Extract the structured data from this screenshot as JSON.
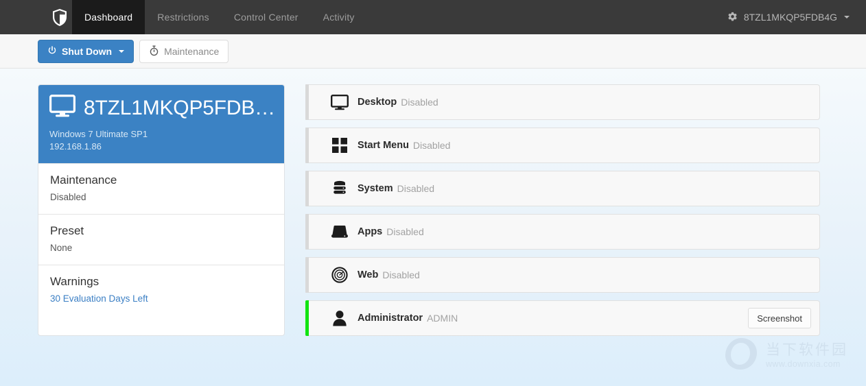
{
  "navbar": {
    "brand_icon": "shield-icon",
    "tabs": [
      {
        "label": "Dashboard",
        "active": true
      },
      {
        "label": "Restrictions",
        "active": false
      },
      {
        "label": "Control Center",
        "active": false
      },
      {
        "label": "Activity",
        "active": false
      }
    ],
    "account": {
      "icon": "gear-icon",
      "label": "8TZL1MKQP5FDB4G",
      "caret": "chevron-down-icon"
    },
    "bg_color": "#3a3a3a",
    "active_tab_color": "#1b1b1b"
  },
  "toolbar": {
    "shutdown_label": "Shut Down",
    "shutdown_icon": "power-icon",
    "maintenance_label": "Maintenance",
    "maintenance_icon": "stopwatch-icon",
    "primary_color": "#3b82c4"
  },
  "device_card": {
    "icon": "monitor-icon",
    "title": "8TZL1MKQP5FDB…",
    "os": "Windows 7 Ultimate SP1",
    "ip": "192.168.1.86",
    "header_color": "#3b82c4",
    "rows": [
      {
        "title": "Maintenance",
        "value": "Disabled",
        "is_link": false
      },
      {
        "title": "Preset",
        "value": "None",
        "is_link": false
      },
      {
        "title": "Warnings",
        "value": "30 Evaluation Days Left",
        "is_link": true
      }
    ]
  },
  "modules": [
    {
      "icon": "monitor-icon",
      "label": "Desktop",
      "state": "Disabled",
      "active": false,
      "action": null
    },
    {
      "icon": "grid-icon",
      "label": "Start Menu",
      "state": "Disabled",
      "active": false,
      "action": null
    },
    {
      "icon": "server-icon",
      "label": "System",
      "state": "Disabled",
      "active": false,
      "action": null
    },
    {
      "icon": "apps-icon",
      "label": "Apps",
      "state": "Disabled",
      "active": false,
      "action": null
    },
    {
      "icon": "web-icon",
      "label": "Web",
      "state": "Disabled",
      "active": false,
      "action": null
    },
    {
      "icon": "user-icon",
      "label": "Administrator",
      "state": "ADMIN",
      "active": true,
      "action": "Screenshot"
    }
  ],
  "module_active_color": "#11e411",
  "watermark": {
    "logo": "o-logo-icon",
    "name": "当下软件园",
    "url": "www.downxia.com"
  }
}
